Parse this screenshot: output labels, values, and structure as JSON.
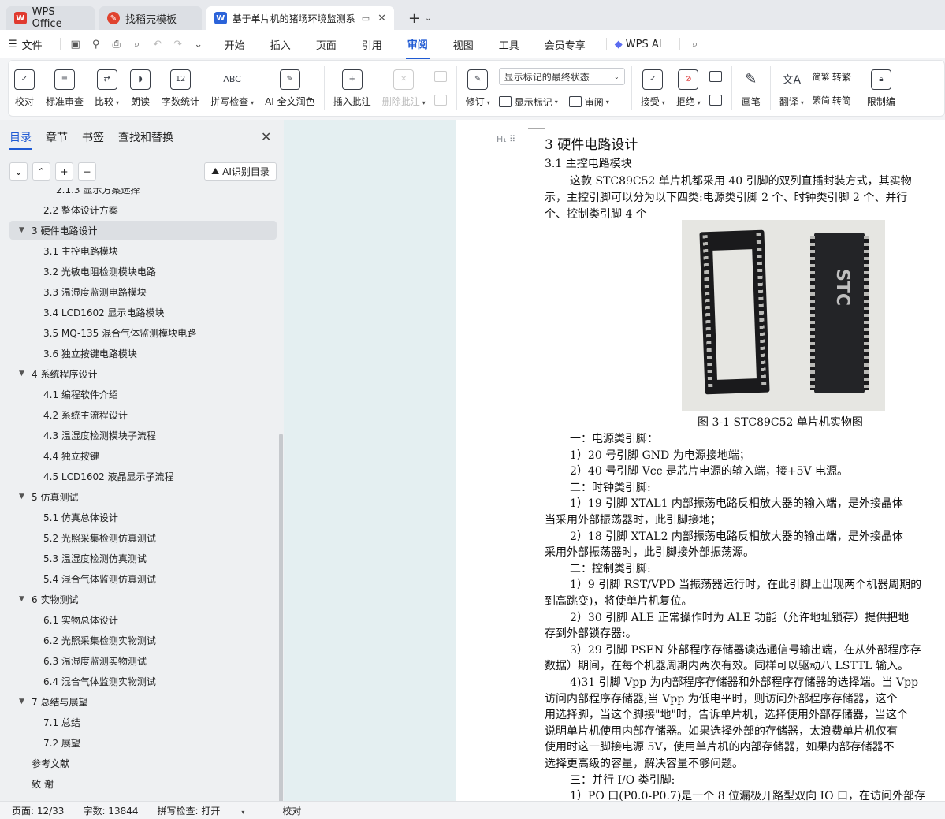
{
  "tabs": [
    {
      "label": "WPS Office",
      "icon": "wps-logo-icon"
    },
    {
      "label": "找稻壳模板",
      "icon": "docer-icon"
    },
    {
      "label": "基于单片机的猪场环境监测系",
      "icon": "word-doc-icon"
    }
  ],
  "menu": {
    "file": "文件",
    "tabs": [
      "开始",
      "插入",
      "页面",
      "引用",
      "审阅",
      "视图",
      "工具",
      "会员专享"
    ],
    "active_tab": "审阅",
    "wps_ai": "WPS AI"
  },
  "ribbon": {
    "proofread": "校对",
    "std_review": "标准审查",
    "compare": "比较",
    "read_aloud": "朗读",
    "word_count": "字数统计",
    "spell_check": "拼写检查",
    "ai_polish": "AI 全文润色",
    "insert_comment": "插入批注",
    "delete_comment": "删除批注",
    "track": "修订",
    "markup_combo": "显示标记的最终状态",
    "show_markup": "显示标记",
    "review_pane": "审阅",
    "accept": "接受",
    "reject": "拒绝",
    "pen": "画笔",
    "translate": "翻译",
    "to_traditional": "转繁",
    "to_simplified": "转简",
    "restrict": "限制编"
  },
  "panel": {
    "tabs": [
      "目录",
      "章节",
      "书签",
      "查找和替换"
    ],
    "active_tab": "目录",
    "ai_toc": "AI识别目录",
    "toc": [
      {
        "text": "2.1.3  显示方案选择",
        "level": 3
      },
      {
        "text": "2.2  整体设计方案",
        "level": 2
      },
      {
        "text": "3    硬件电路设计",
        "level": 1,
        "expanded": true,
        "selected": true
      },
      {
        "text": "3.1  主控电路模块",
        "level": 2
      },
      {
        "text": "3.2  光敏电阻检测模块电路",
        "level": 2
      },
      {
        "text": "3.3  温湿度监测电路模块",
        "level": 2
      },
      {
        "text": "3.4 LCD1602 显示电路模块",
        "level": 2
      },
      {
        "text": "3.5 MQ-135 混合气体监测模块电路",
        "level": 2
      },
      {
        "text": "3.6  独立按键电路模块",
        "level": 2
      },
      {
        "text": "4    系统程序设计",
        "level": 1,
        "expanded": true
      },
      {
        "text": "4.1  编程软件介绍",
        "level": 2
      },
      {
        "text": "4.2  系统主流程设计",
        "level": 2
      },
      {
        "text": "4.3  温湿度检测模块子流程",
        "level": 2
      },
      {
        "text": "4.4  独立按键",
        "level": 2
      },
      {
        "text": "4.5 LCD1602 液晶显示子流程",
        "level": 2
      },
      {
        "text": "5    仿真测试",
        "level": 1,
        "expanded": true
      },
      {
        "text": "5.1  仿真总体设计",
        "level": 2
      },
      {
        "text": "5.2  光照采集检测仿真测试",
        "level": 2
      },
      {
        "text": "5.3  温湿度检测仿真测试",
        "level": 2
      },
      {
        "text": "5.4  混合气体监测仿真测试",
        "level": 2
      },
      {
        "text": "6    实物测试",
        "level": 1,
        "expanded": true
      },
      {
        "text": "6.1  实物总体设计",
        "level": 2
      },
      {
        "text": "6.2  光照采集检测实物测试",
        "level": 2
      },
      {
        "text": "6.3  温湿度监测实物测试",
        "level": 2
      },
      {
        "text": "6.4  混合气体监测实物测试",
        "level": 2
      },
      {
        "text": "7    总结与展望",
        "level": 1,
        "expanded": true
      },
      {
        "text": "7.1  总结",
        "level": 2
      },
      {
        "text": "7.2  展望",
        "level": 2
      },
      {
        "text": "参考文献",
        "level": 1
      },
      {
        "text": "致    谢",
        "level": 1
      }
    ]
  },
  "doc": {
    "h1": "3    硬件电路设计",
    "h2": "3.1  主控电路模块",
    "photo_text": "STC",
    "caption": "图 3-1 STC89C52 单片机实物图",
    "p1": [
      "这款 STC89C52 单片机都采用 40 引脚的双列直插封装方式，其实物",
      "示，主控引脚可以分为以下四类:电源类引脚 2 个、时钟类引脚 2 个、并行",
      "个、控制类引脚 4 个"
    ],
    "body": [
      "一：电源类引脚：",
      "1）20 号引脚 GND 为电源接地端；",
      "2）40 号引脚 Vcc 是芯片电源的输入端，接+5V 电源。",
      "二：时钟类引脚:",
      "1）19 引脚 XTAL1 内部振荡电路反相放大器的输入端，是外接晶体",
      "当采用外部振荡器时，此引脚接地；",
      "2）18 引脚 XTAL2 内部振荡电路反相放大器的输出端，是外接晶体",
      "采用外部振荡器时，此引脚接外部振荡源。",
      "二：控制类引脚:",
      "1）9 引脚 RST/VPD 当振荡器运行时，在此引脚上出现两个机器周期的",
      "到高跳变)，将使单片机复位。",
      "2）30 引脚 ALE 正常操作时为 ALE 功能（允许地址锁存）提供把地",
      "存到外部锁存器:。",
      "3）29 引脚 PSEN 外部程序存储器读选通信号输出端，在从外部程序存",
      "数据）期间，在每个机器周期内两次有效。同样可以驱动八 LSTTL 输入。",
      "4)31 引脚 Vpp 为内部程序存储器和外部程序存储器的选择端。当 Vpp",
      "访问内部程序存储器;当 Vpp 为低电平时，则访问外部程序存储器，这个",
      "用选择脚，当这个脚接\"地\"时，告诉单片机，选择使用外部存储器，当这个",
      "说明单片机使用内部存储器。如果选择外部的存储器，太浪费单片机仅有",
      "使用时这一脚接电源 5V，使用单片机的内部存储器，如果内部存储器不",
      "选择更高级的容量，解决容量不够问题。",
      "三：并行 I/O 类引脚:",
      "1）PO 口(P0.0-P0.7)是一个 8 位漏极开路型双向 IO 口，在访问外部存"
    ]
  },
  "status": {
    "page": "页面: 12/33",
    "words": "字数: 13844",
    "spell": "拼写检查: 打开",
    "proof": "校对"
  },
  "colors": {
    "accent": "#1f5ad3",
    "wps_red": "#e03a2f",
    "word_blue": "#2b63d9"
  }
}
